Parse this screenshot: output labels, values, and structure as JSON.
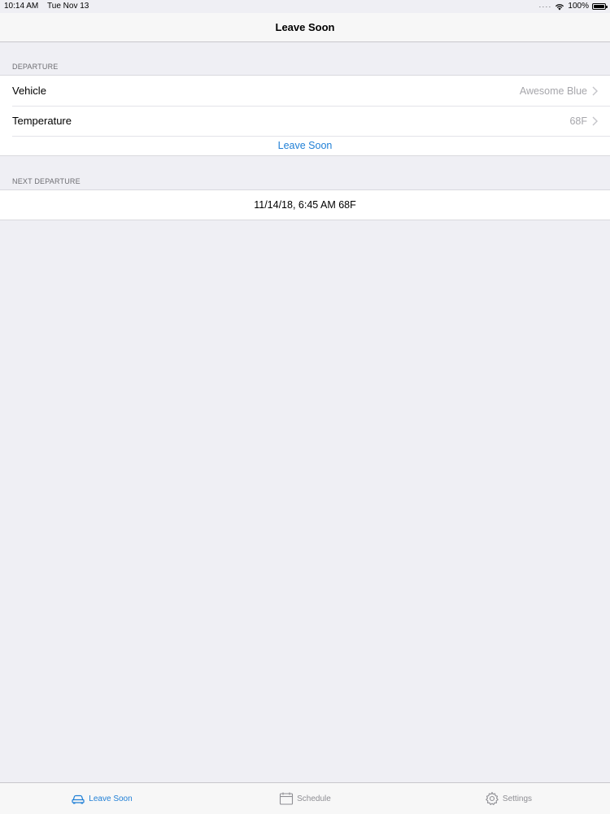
{
  "status_bar": {
    "time": "10:14 AM",
    "date": "Tue Nov 13",
    "battery": "100%",
    "battery_level": 1.0
  },
  "nav": {
    "title": "Leave Soon"
  },
  "departure": {
    "header": "DEPARTURE",
    "rows": [
      {
        "label": "Vehicle",
        "value": "Awesome Blue"
      },
      {
        "label": "Temperature",
        "value": "68F"
      }
    ],
    "action_label": "Leave Soon"
  },
  "next_departure": {
    "header": "NEXT DEPARTURE",
    "value": "11/14/18, 6:45 AM 68F"
  },
  "tabs": [
    {
      "label": "Leave Soon",
      "icon": "car-icon",
      "active": true
    },
    {
      "label": "Schedule",
      "icon": "calendar-icon",
      "active": false
    },
    {
      "label": "Settings",
      "icon": "gear-icon",
      "active": false
    }
  ],
  "colors": {
    "accent": "#1f7fd6",
    "background": "#efeff4",
    "secondary_text": "#a6a6ab"
  }
}
